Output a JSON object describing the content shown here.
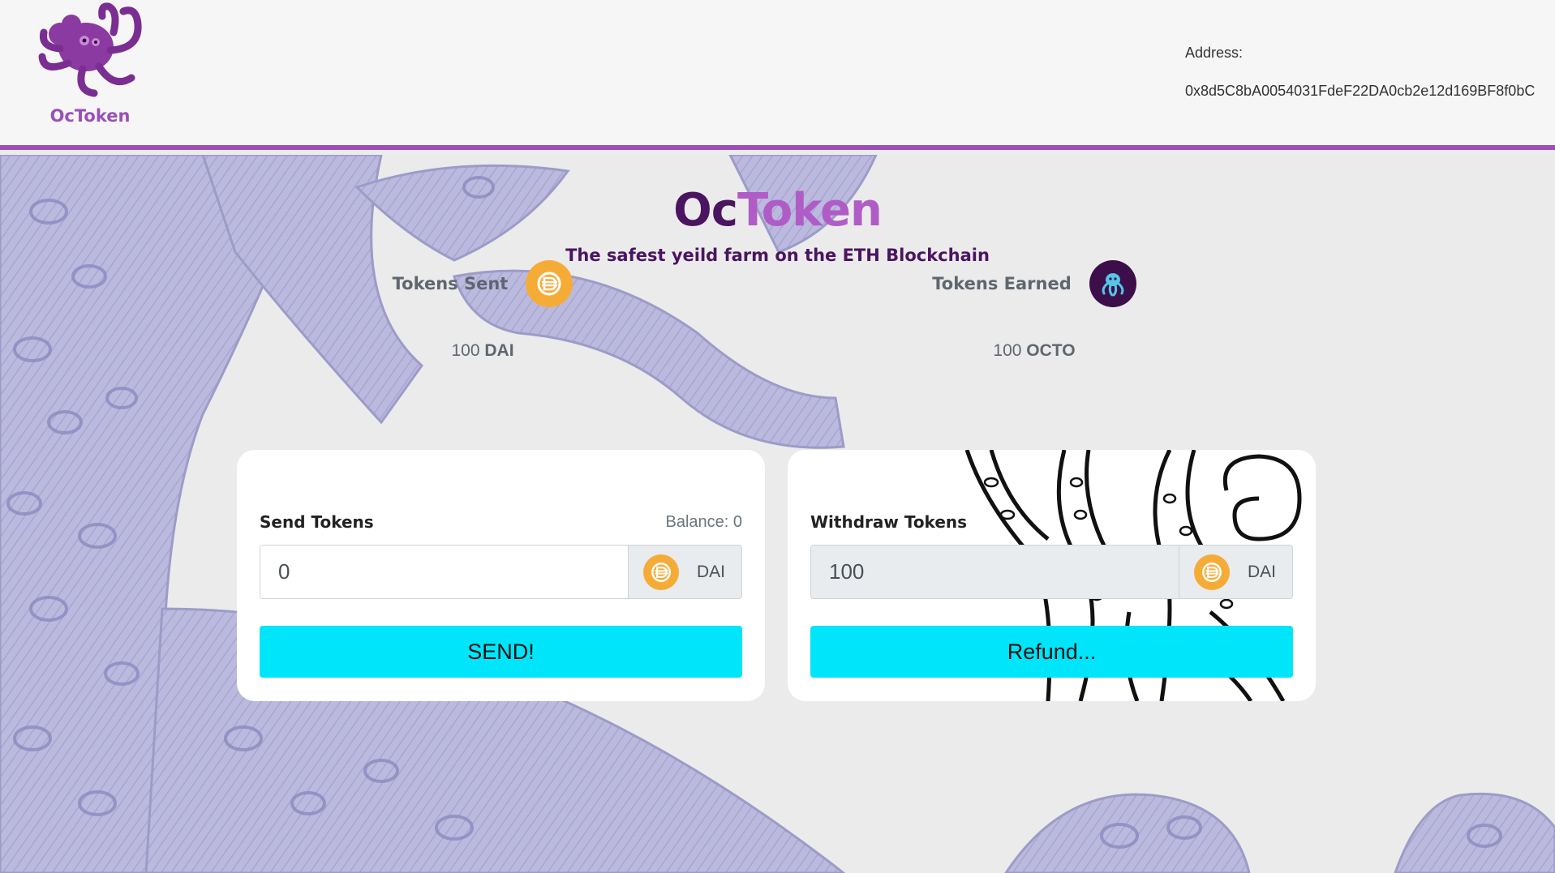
{
  "header": {
    "brand_name": "OcToken",
    "address_label": "Address:",
    "address_value": "0x8d5C8bA0054031FdeF22DA0cb2e12d169BF8f0bC"
  },
  "hero": {
    "title_part1": "Oc",
    "title_part2": "Token",
    "subtitle": "The safest yeild farm on the ETH Blockchain"
  },
  "stats": {
    "sent": {
      "label": "Tokens Sent",
      "amount": "100",
      "unit": "DAI",
      "icon": "dai-coin-icon"
    },
    "earned": {
      "label": "Tokens Earned",
      "amount": "100",
      "unit": "OCTO",
      "icon": "octo-coin-icon"
    }
  },
  "send_card": {
    "title": "Send Tokens",
    "balance": "Balance: 0",
    "input_value": "0",
    "token": "DAI",
    "button_label": "SEND!"
  },
  "withdraw_card": {
    "title": "Withdraw Tokens",
    "input_value": "100",
    "token": "DAI",
    "button_label": "Refund..."
  },
  "colors": {
    "brand_purple": "#9b4fb7",
    "dark_purple": "#4a1460",
    "accent_cyan": "#00e5fa",
    "dai_gold": "#f5ac37"
  }
}
